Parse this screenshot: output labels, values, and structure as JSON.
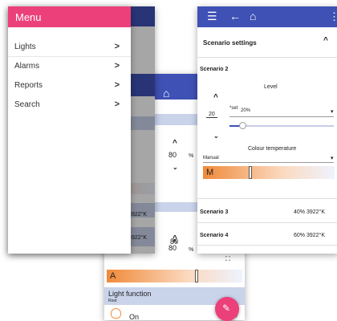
{
  "menu": {
    "title": "Menu",
    "items": [
      {
        "label": "Lights",
        "chevron": ">"
      },
      {
        "label": "Alarms",
        "chevron": ">"
      },
      {
        "label": "Reports",
        "chevron": ">"
      },
      {
        "label": "Search",
        "chevron": ">"
      }
    ]
  },
  "middle_screen": {
    "value1": "80",
    "value2": "80",
    "unit": "%",
    "info1": "0% 3922°K",
    "info2": "0% 3922°K"
  },
  "bottom_screen": {
    "gradient_letter": "A",
    "light_function": "Light function",
    "sub": "Root",
    "state": "On"
  },
  "right_screen": {
    "section": "Scenario settings",
    "scenario2": "Scenario 2",
    "level_label": "Level",
    "level_value": "20",
    "set_label": "*set",
    "set_value": "20%",
    "colour_label": "Colour temperature",
    "colour_mode": "Manual",
    "gradient_letter": "M",
    "scenario3": "Scenario 3",
    "scenario3_info": "40% 3922°K",
    "scenario4": "Scenario 4",
    "scenario4_info": "60% 3922°K"
  },
  "colors": {
    "primary": "#3f51b5",
    "accent": "#ec407a"
  }
}
